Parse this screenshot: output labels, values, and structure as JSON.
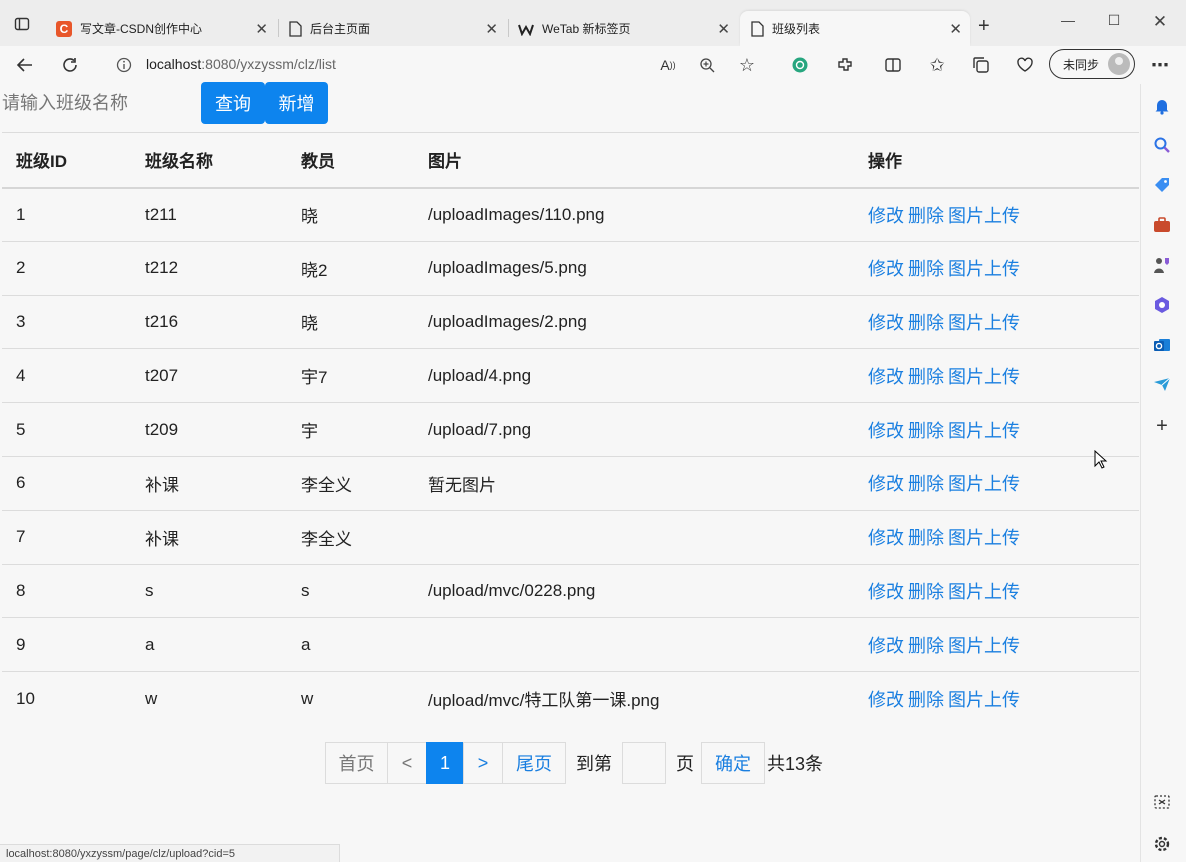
{
  "browser": {
    "tabs": [
      {
        "title": "写文章-CSDN创作中心",
        "icon": "csdn-icon",
        "icon_color": "#e8562a"
      },
      {
        "title": "后台主页面",
        "icon": "page-icon"
      },
      {
        "title": "WeTab 新标签页",
        "icon": "wetab-icon"
      },
      {
        "title": "班级列表",
        "icon": "page-icon",
        "active": true
      }
    ],
    "address": {
      "host": "localhost",
      "path": ":8080/yxzyssm/clz/list"
    },
    "sync_label": "未同步"
  },
  "search": {
    "placeholder": "请输入班级名称",
    "query_label": "查询",
    "add_label": "新增"
  },
  "table": {
    "headers": [
      "班级ID",
      "班级名称",
      "教员",
      "图片",
      "操作"
    ],
    "rows": [
      {
        "id": "1",
        "name": "t211",
        "teacher": "晓",
        "image": "/uploadImages/110.png"
      },
      {
        "id": "2",
        "name": "t212",
        "teacher": "晓2",
        "image": "/uploadImages/5.png"
      },
      {
        "id": "3",
        "name": "t216",
        "teacher": "晓",
        "image": "/uploadImages/2.png"
      },
      {
        "id": "4",
        "name": "t207",
        "teacher": "宇7",
        "image": "/upload/4.png"
      },
      {
        "id": "5",
        "name": "t209",
        "teacher": "宇",
        "image": "/upload/7.png"
      },
      {
        "id": "6",
        "name": "补课",
        "teacher": "李全义",
        "image": "暂无图片"
      },
      {
        "id": "7",
        "name": "补课",
        "teacher": "李全义",
        "image": ""
      },
      {
        "id": "8",
        "name": "s",
        "teacher": "s",
        "image": "/upload/mvc/0228.png"
      },
      {
        "id": "9",
        "name": "a",
        "teacher": "a",
        "image": ""
      },
      {
        "id": "10",
        "name": "w",
        "teacher": "w",
        "image": "/upload/mvc/特工队第一课.png"
      }
    ],
    "actions": {
      "edit": "修改",
      "delete": "删除",
      "upload": "图片上传"
    }
  },
  "pager": {
    "first": "首页",
    "prev": "<",
    "current": "1",
    "next": ">",
    "last": "尾页",
    "goto_prefix": "到第",
    "goto_suffix": "页",
    "confirm": "确定",
    "total": "共13条"
  },
  "status_url": "localhost:8080/yxzyssm/page/clz/upload?cid=5",
  "colors": {
    "primary": "#0d84ee",
    "link": "#1a7fe0"
  }
}
